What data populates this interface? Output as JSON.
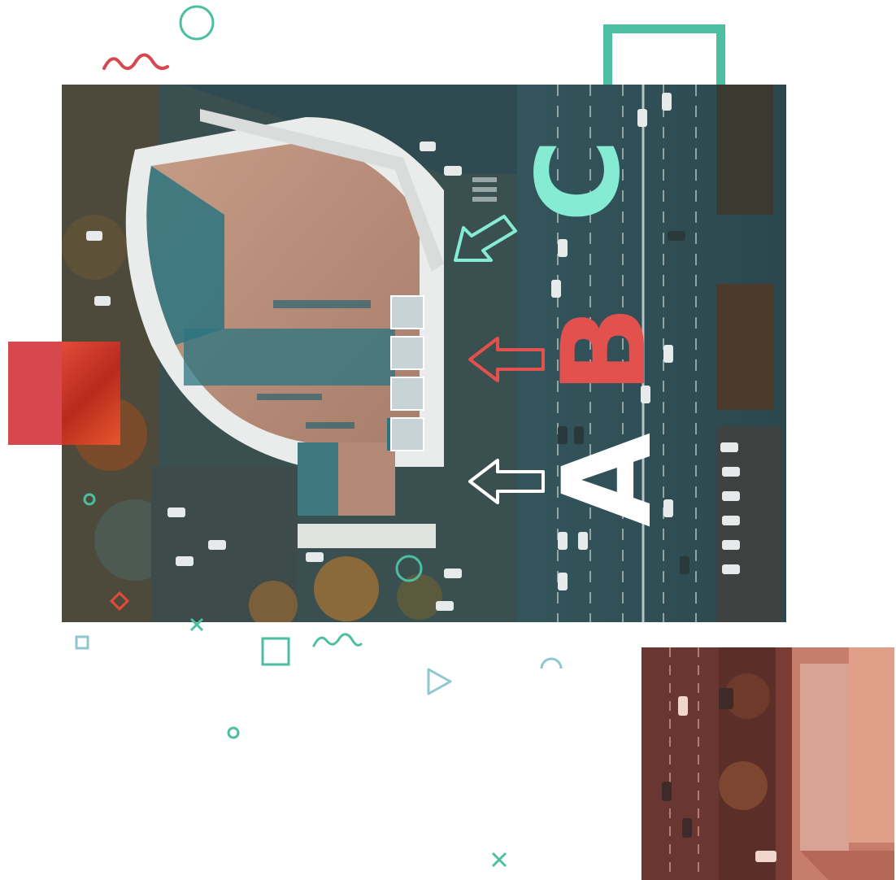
{
  "letters": {
    "a": "A",
    "b": "B",
    "c": "C"
  },
  "colors": {
    "teal": "#4cbfa3",
    "mint": "#86ebd3",
    "red": "#d6484e",
    "coral": "#e3514f",
    "white": "#ffffff"
  },
  "icons": [
    "circle-icon",
    "wave-icon",
    "square-frame-icon",
    "arrow-left-icon",
    "cross-icon",
    "triangle-icon",
    "diamond-icon",
    "arc-icon"
  ]
}
